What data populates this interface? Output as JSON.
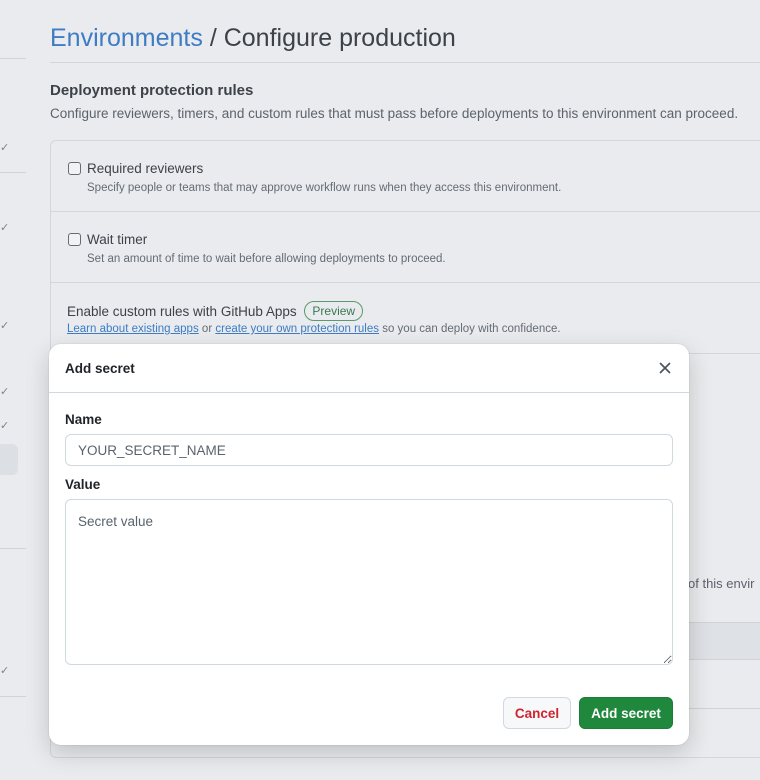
{
  "breadcrumb": {
    "parent": "Environments",
    "separator": "/",
    "current": "Configure production"
  },
  "protection": {
    "heading": "Deployment protection rules",
    "description": "Configure reviewers, timers, and custom rules that must pass before deployments to this environment can proceed.",
    "rules": [
      {
        "title": "Required reviewers",
        "description": "Specify people or teams that may approve workflow runs when they access this environment."
      },
      {
        "title": "Wait timer",
        "description": "Set an amount of time to wait before allowing deployments to proceed."
      }
    ],
    "custom": {
      "title": "Enable custom rules with GitHub Apps",
      "badge": "Preview",
      "link1": "Learn about existing apps",
      "or": "or",
      "link2": "create your own protection rules",
      "suffix": "so you can deploy with confidence."
    },
    "peek_text": "of this envir"
  },
  "modal": {
    "title": "Add secret",
    "close_icon": "x-icon",
    "name_label": "Name",
    "name_placeholder": "YOUR_SECRET_NAME",
    "value_label": "Value",
    "value_placeholder": "Secret value",
    "cancel_label": "Cancel",
    "submit_label": "Add secret"
  },
  "colors": {
    "link": "#3e7cc4",
    "primary_button": "#1f883d",
    "danger_text": "#d1242f",
    "backdrop": "#e9ebee"
  }
}
